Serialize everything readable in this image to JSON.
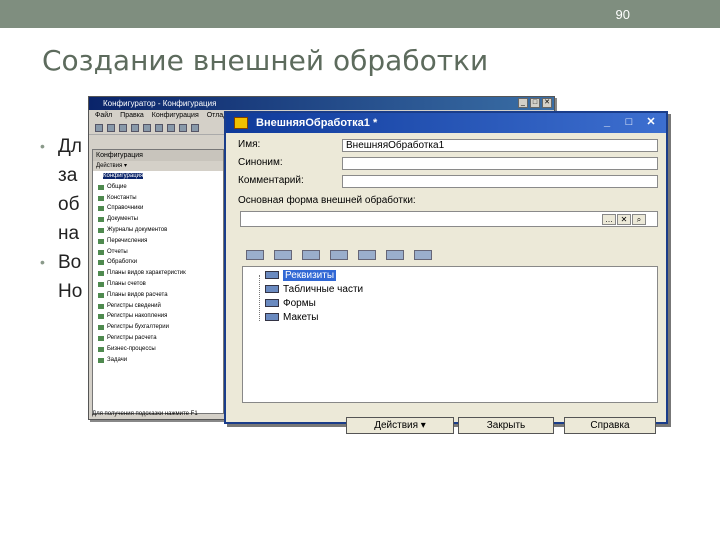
{
  "slide": {
    "number": "90",
    "title": "Создание внешней обработки",
    "bullets": [
      {
        "lines": [
          "Дл",
          "за",
          "об",
          "на"
        ]
      },
      {
        "lines": [
          "Во",
          "Но"
        ]
      }
    ]
  },
  "config_window": {
    "title": "Конфигуратор - Конфигурация",
    "menu": [
      "Файл",
      "Правка",
      "Конфигурация",
      "Отладка"
    ],
    "tree_title": "Конфигурация",
    "tree_actions": "Действия ▾",
    "tree_items": [
      "Конфигурация",
      "Общие",
      "Константы",
      "Справочники",
      "Документы",
      "Журналы документов",
      "Перечисления",
      "Отчеты",
      "Обработки",
      "Планы видов характеристик",
      "Планы счетов",
      "Планы видов расчета",
      "Регистры сведений",
      "Регистры накопления",
      "Регистры бухгалтерии",
      "Регистры расчета",
      "Бизнес-процессы",
      "Задачи"
    ],
    "status": "Для получения подсказки нажмите F1"
  },
  "dialog": {
    "title": "ВнешняяОбработка1 *",
    "name_label": "Имя:",
    "name_value": "ВнешняяОбработка1",
    "synonym_label": "Синоним:",
    "synonym_value": "",
    "comment_label": "Комментарий:",
    "comment_value": "",
    "main_form_label": "Основная форма внешней обработки:",
    "main_form_value": "",
    "tree": [
      "Реквизиты",
      "Табличные части",
      "Формы",
      "Макеты"
    ],
    "buttons": {
      "actions": "Действия ▾",
      "close": "Закрыть",
      "help": "Справка"
    },
    "window_controls": {
      "minimize": "_",
      "maximize": "□",
      "close": "✕"
    }
  }
}
